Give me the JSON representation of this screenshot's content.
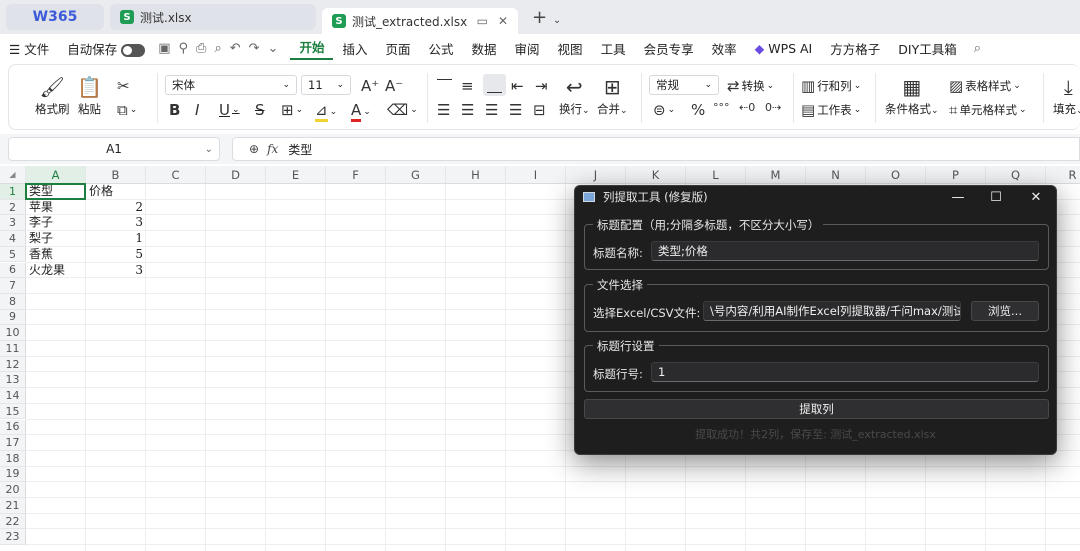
{
  "tabs": {
    "logo": "W365",
    "file1": "测试.xlsx",
    "file2": "测试_extracted.xlsx",
    "file_icon": "S"
  },
  "menu": {
    "file": "文件",
    "autosave": "自动保存",
    "items": [
      "开始",
      "插入",
      "页面",
      "公式",
      "数据",
      "审阅",
      "视图",
      "工具",
      "会员专享",
      "效率",
      "WPS AI",
      "方方格子",
      "DIY工具箱"
    ]
  },
  "ribbon": {
    "format_painter": "格式刷",
    "paste": "粘贴",
    "font_name": "宋体",
    "font_size": "11",
    "number_format": "常规",
    "convert": "转换",
    "rows_cols": "行和列",
    "table_style": "表格样式",
    "wrap": "换行",
    "merge": "合并",
    "worksheet": "工作表",
    "cond_format": "条件格式",
    "cell_style": "单元格样式",
    "fill": "填充",
    "bold": "B",
    "italic": "I",
    "underline": "U",
    "strike": "S",
    "percent": "%",
    "font_a": "A"
  },
  "formula_bar": {
    "name_box": "A1",
    "fx": "fx",
    "content": "类型"
  },
  "sheet": {
    "columns": [
      "A",
      "B",
      "C",
      "D",
      "E",
      "F",
      "G",
      "H",
      "I",
      "J",
      "K",
      "L",
      "M",
      "N",
      "O",
      "P",
      "Q",
      "R"
    ],
    "rows": [
      "1",
      "2",
      "3",
      "4",
      "5",
      "6",
      "7",
      "8",
      "9",
      "10",
      "11",
      "12",
      "13",
      "14",
      "15",
      "16",
      "17",
      "18",
      "19",
      "20",
      "21",
      "22",
      "23"
    ],
    "cells": [
      [
        "类型",
        "价格"
      ],
      [
        "苹果",
        "2"
      ],
      [
        "李子",
        "3"
      ],
      [
        "梨子",
        "1"
      ],
      [
        "香蕉",
        "5"
      ],
      [
        "火龙果",
        "3"
      ]
    ]
  },
  "dialog": {
    "title": "列提取工具 (修复版)",
    "group1": "标题配置（用;分隔多标题，不区分大小写）",
    "title_label": "标题名称:",
    "title_value": "类型;价格",
    "group2": "文件选择",
    "file_label": "选择Excel/CSV文件:",
    "file_value": "\\号内容/利用AI制作Excel列提取器/千问max/测试.xlsx",
    "browse": "浏览...",
    "group3": "标题行设置",
    "row_label": "标题行号:",
    "row_value": "1",
    "extract": "提取列",
    "status": "提取成功！共2列，保存至: 测试_extracted.xlsx"
  }
}
